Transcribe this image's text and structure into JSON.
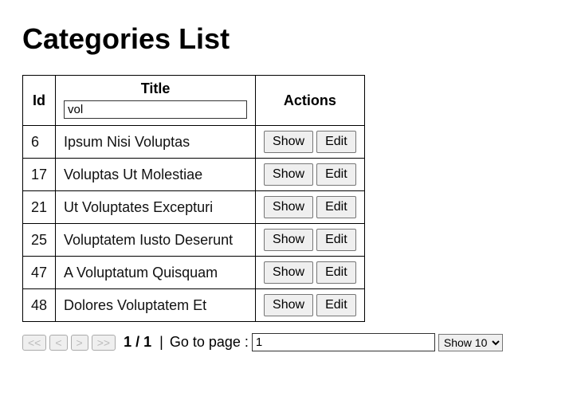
{
  "page_title": "Categories List",
  "table": {
    "headers": {
      "id": "Id",
      "title": "Title",
      "actions": "Actions"
    },
    "title_filter_value": "vol",
    "action_labels": {
      "show": "Show",
      "edit": "Edit"
    },
    "rows": [
      {
        "id": "6",
        "title": "Ipsum Nisi Voluptas"
      },
      {
        "id": "17",
        "title": "Voluptas Ut Molestiae"
      },
      {
        "id": "21",
        "title": "Ut Voluptates Excepturi"
      },
      {
        "id": "25",
        "title": "Voluptatem Iusto Deserunt"
      },
      {
        "id": "47",
        "title": "A Voluptatum Quisquam"
      },
      {
        "id": "48",
        "title": "Dolores Voluptatem Et"
      }
    ]
  },
  "pager": {
    "first_label": "<<",
    "prev_label": "<",
    "next_label": ">",
    "last_label": ">>",
    "page_indicator": "1 / 1",
    "go_to_page_label": "Go to page :",
    "separator": "|",
    "page_input_value": "1",
    "page_size_selected": "Show 10",
    "page_size_options": [
      "Show 10"
    ]
  }
}
